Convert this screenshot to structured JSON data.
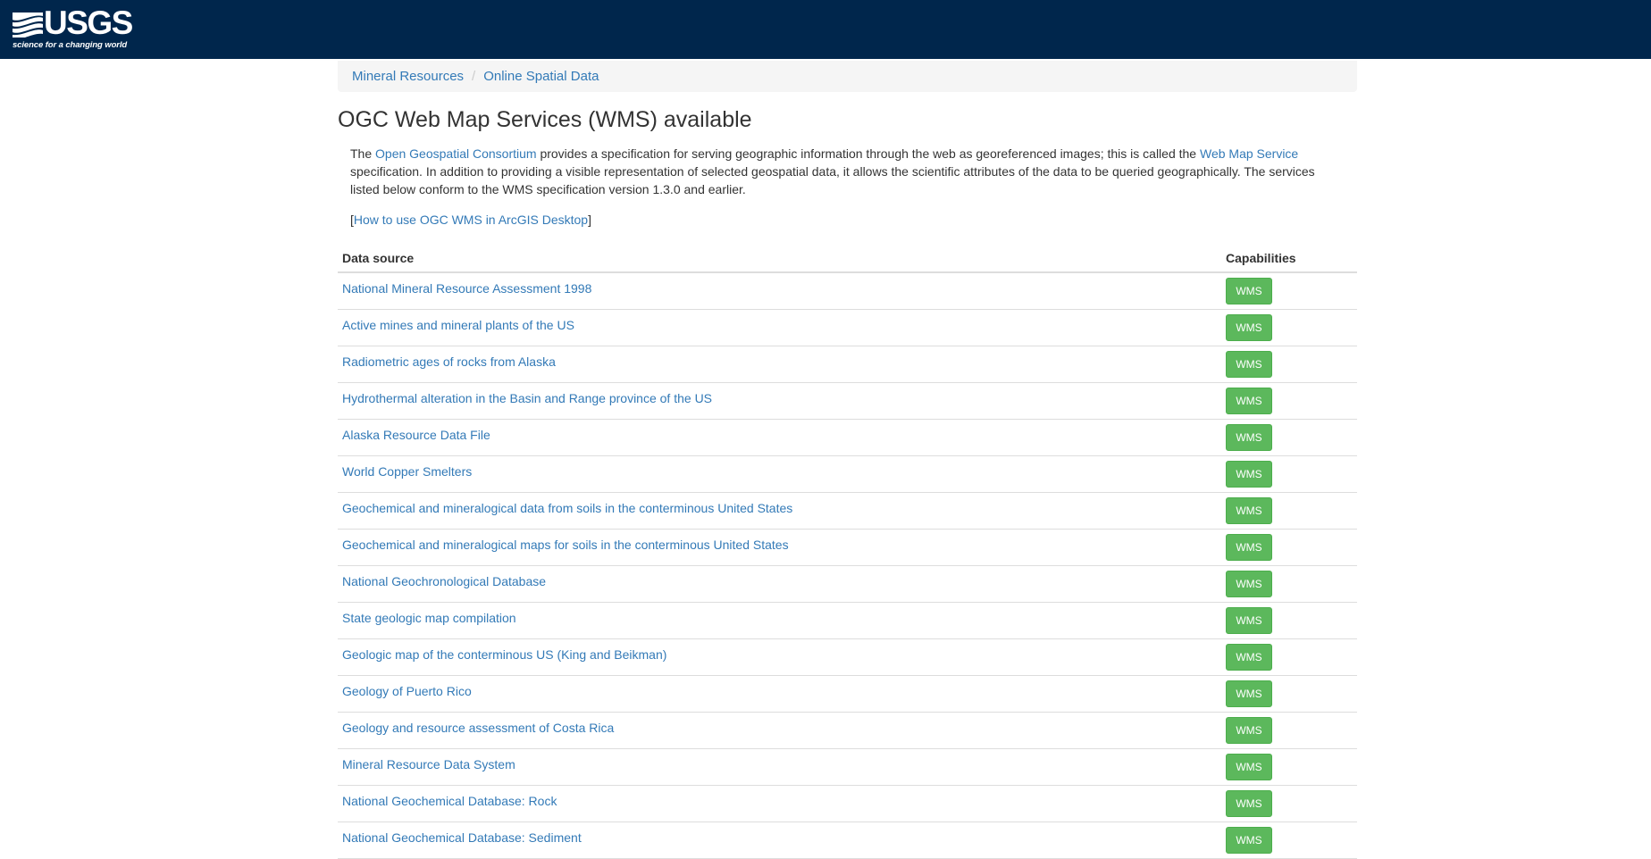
{
  "header": {
    "logo_text": "USGS",
    "tagline": "science for a changing world"
  },
  "breadcrumb": [
    {
      "label": "Mineral Resources"
    },
    {
      "label": "Online Spatial Data"
    }
  ],
  "page": {
    "title": "OGC Web Map Services (WMS) available",
    "intro_1": "The ",
    "intro_link_1": "Open Geospatial Consortium",
    "intro_2": " provides a specification for serving geographic information through the web as georeferenced images; this is called the ",
    "intro_link_2": "Web Map Service",
    "intro_3": " specification. In addition to providing a visible representation of selected geospatial data, it allows the scientific attributes of the data to be queried geographically. The services listed below conform to the WMS specification version 1.3.0 and earlier.",
    "howto_open": "[",
    "howto_link": "How to use OGC WMS in ArcGIS Desktop",
    "howto_close": "]"
  },
  "table": {
    "headers": {
      "source": "Data source",
      "capabilities": "Capabilities"
    },
    "button_label": "WMS",
    "rows": [
      {
        "source": "National Mineral Resource Assessment 1998"
      },
      {
        "source": "Active mines and mineral plants of the US"
      },
      {
        "source": "Radiometric ages of rocks from Alaska"
      },
      {
        "source": "Hydrothermal alteration in the Basin and Range province of the US"
      },
      {
        "source": "Alaska Resource Data File"
      },
      {
        "source": "World Copper Smelters"
      },
      {
        "source": "Geochemical and mineralogical data from soils in the conterminous United States"
      },
      {
        "source": "Geochemical and mineralogical maps for soils in the conterminous United States"
      },
      {
        "source": "National Geochronological Database"
      },
      {
        "source": "State geologic map compilation"
      },
      {
        "source": "Geologic map of the conterminous US (King and Beikman)"
      },
      {
        "source": "Geology of Puerto Rico"
      },
      {
        "source": "Geology and resource assessment of Costa Rica"
      },
      {
        "source": "Mineral Resource Data System"
      },
      {
        "source": "National Geochemical Database: Rock"
      },
      {
        "source": "National Geochemical Database: Sediment"
      }
    ]
  },
  "colors": {
    "header_bg": "#00264c",
    "link": "#337ab7",
    "button_bg": "#5cb85c"
  }
}
